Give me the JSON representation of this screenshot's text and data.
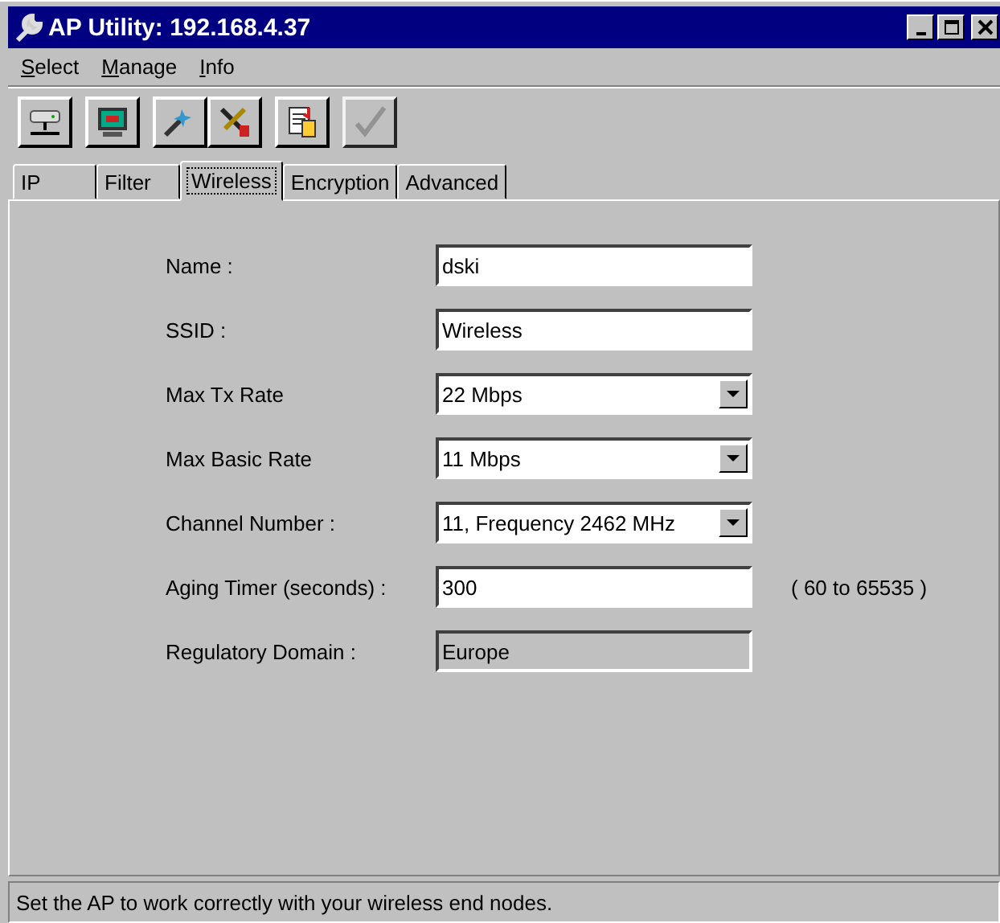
{
  "window": {
    "title": "AP Utility: 192.168.4.37"
  },
  "menu": [
    {
      "label": "Select"
    },
    {
      "label": "Manage"
    },
    {
      "label": "Info"
    }
  ],
  "toolbar": [
    [
      {
        "kind": "network",
        "disabled": false
      }
    ],
    [
      {
        "kind": "monitor",
        "disabled": false
      }
    ],
    [
      {
        "kind": "wand",
        "disabled": false
      },
      {
        "kind": "tools",
        "disabled": false
      }
    ],
    [
      {
        "kind": "paste",
        "disabled": false
      }
    ],
    [
      {
        "kind": "check",
        "disabled": true
      }
    ]
  ],
  "tabs": [
    {
      "label": "IP",
      "selected": false
    },
    {
      "label": "Filter",
      "selected": false
    },
    {
      "label": "Wireless",
      "selected": true
    },
    {
      "label": "Encryption",
      "selected": false
    },
    {
      "label": "Advanced",
      "selected": false
    }
  ],
  "fields": [
    {
      "label": "Name :",
      "kind": "text",
      "value": "dski",
      "disabled": false
    },
    {
      "label": "SSID :",
      "kind": "text",
      "value": "Wireless",
      "disabled": false
    },
    {
      "label": "Max Tx Rate",
      "kind": "dropdown",
      "value": "22 Mbps",
      "disabled": false
    },
    {
      "label": "Max Basic Rate",
      "kind": "dropdown",
      "value": "11 Mbps",
      "disabled": false
    },
    {
      "label": "Channel Number :",
      "kind": "dropdown",
      "value": "11, Frequency 2462 MHz",
      "disabled": false
    },
    {
      "label": "Aging Timer (seconds) :",
      "kind": "text",
      "value": "300",
      "disabled": false,
      "hint": "( 60 to 65535 )"
    },
    {
      "label": "Regulatory Domain :",
      "kind": "text",
      "value": "Europe",
      "disabled": true
    }
  ],
  "status_bar": "Set the AP to work correctly with your wireless end nodes."
}
